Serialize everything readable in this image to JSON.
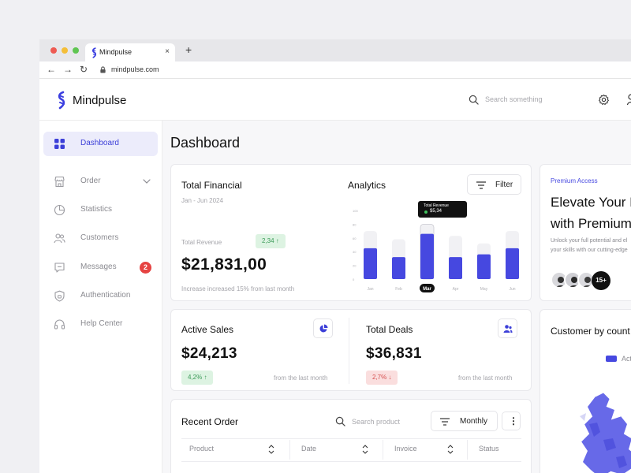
{
  "browser": {
    "tab_title": "Mindpulse",
    "tab_close": "×",
    "new_tab": "+",
    "back": "←",
    "forward": "→",
    "reload": "↻",
    "url": "mindpulse.com"
  },
  "header": {
    "brand": "Mindpulse",
    "search_placeholder": "Search something"
  },
  "sidebar": {
    "items": [
      {
        "label": "Dashboard",
        "icon": "grid-icon",
        "active": true
      },
      {
        "label": "Order",
        "icon": "store-icon"
      },
      {
        "label": "Statistics",
        "icon": "pie-chart-icon"
      },
      {
        "label": "Customers",
        "icon": "users-icon"
      },
      {
        "label": "Messages",
        "icon": "message-icon",
        "badge": "2"
      },
      {
        "label": "Authentication",
        "icon": "shield-icon"
      },
      {
        "label": "Help Center",
        "icon": "headset-icon"
      }
    ]
  },
  "page": {
    "title": "Dashboard"
  },
  "financial": {
    "title": "Total Financial",
    "range": "Jan - Jun 2024",
    "revenue_label": "Total Revenue",
    "change": "2,34 ↑",
    "value": "$21,831,00",
    "note": "Increase increased 15% from last month"
  },
  "analytics": {
    "title": "Analytics",
    "filter_label": "Filter",
    "tooltip_label": "Total Revenue",
    "tooltip_value": "$5,34"
  },
  "chart_data": {
    "type": "bar",
    "categories": [
      "Jan",
      "Feb",
      "Mar",
      "Apr",
      "May",
      "Jun"
    ],
    "values": [
      45,
      32,
      66,
      32,
      36,
      45
    ],
    "background_values": [
      70,
      58,
      80,
      63,
      52,
      70
    ],
    "y_ticks": [
      "100",
      "80",
      "60",
      "40",
      "20",
      "0"
    ],
    "ylim": [
      0,
      100
    ],
    "highlight": "Mar",
    "color": "#4648e0",
    "background_color": "#f1f1f4"
  },
  "active_sales": {
    "title": "Active Sales",
    "value": "$24,213",
    "change": "4,2% ↑",
    "note": "from the last month"
  },
  "total_deals": {
    "title": "Total Deals",
    "value": "$36,831",
    "change": "2,7% ↓",
    "note": "from the last month"
  },
  "premium": {
    "tag": "Premium Access",
    "heading_1": "Elevate Your B",
    "heading_2": "with Premium",
    "desc_1": "Unlock your full potential and el",
    "desc_2": "your skills with our cutting-edge",
    "more": "15+"
  },
  "customer_country": {
    "title": "Customer by count",
    "legend": "Act"
  },
  "recent_order": {
    "title": "Recent Order",
    "search_placeholder": "Search product",
    "period": "Monthly",
    "more": "⋮",
    "columns": [
      "Product",
      "Date",
      "Invoice",
      "Status"
    ]
  },
  "colors": {
    "accent": "#4648e0",
    "active_bg": "#ececfb",
    "positive": "#3a9a57",
    "negative": "#d65050",
    "badge": "#e64342"
  }
}
